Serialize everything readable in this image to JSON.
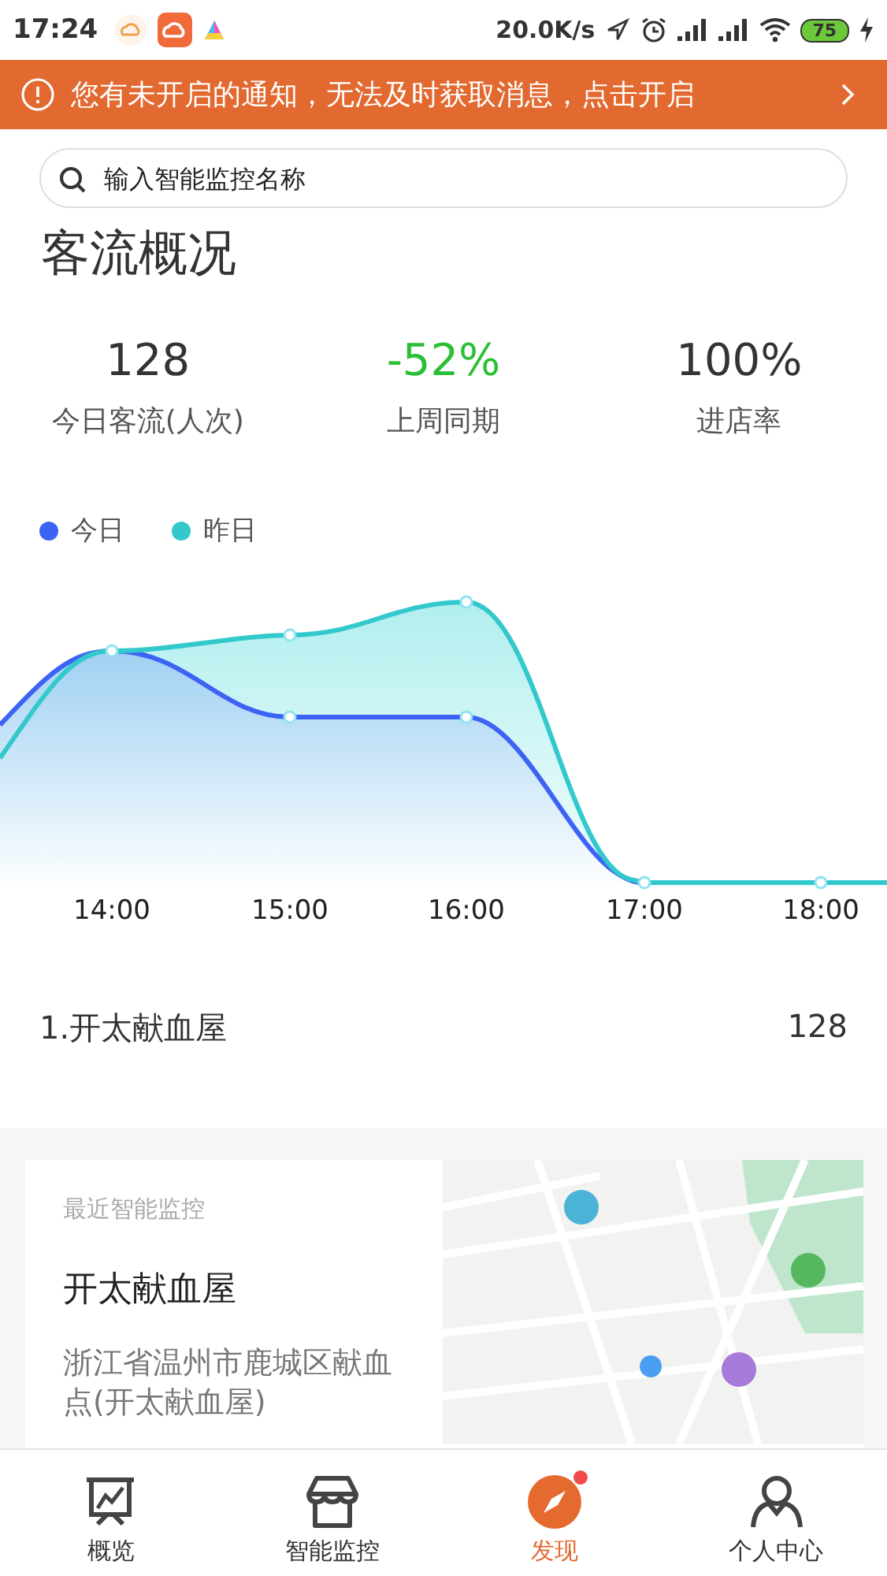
{
  "status_bar": {
    "time": "17:24",
    "speed": "20.0K/s",
    "battery": "75"
  },
  "notice": {
    "text": "您有未开启的通知，无法及时获取消息，点击开启"
  },
  "search": {
    "placeholder": "输入智能监控名称"
  },
  "section_title": "客流概况",
  "stats": [
    {
      "value": "128",
      "label": "今日客流(人次)",
      "kind": "normal"
    },
    {
      "value": "-52%",
      "label": "上周同期",
      "kind": "change"
    },
    {
      "value": "100%",
      "label": "进店率",
      "kind": "normal"
    }
  ],
  "chart": {
    "legend": [
      {
        "label": "今日",
        "color": "#3d63f5"
      },
      {
        "label": "昨日",
        "color": "#33c9cc"
      }
    ],
    "x_labels": [
      "14:00",
      "15:00",
      "16:00",
      "17:00",
      "18:00"
    ]
  },
  "ranking": [
    {
      "name": "1.开太献血屋",
      "count": "128"
    }
  ],
  "recent": {
    "heading": "最近智能监控",
    "name": "开太献血屋",
    "address": "浙江省温州市鹿城区献血点(开太献血屋)"
  },
  "nav": [
    {
      "label": "概览",
      "selected": false,
      "badge": false
    },
    {
      "label": "智能监控",
      "selected": false,
      "badge": false
    },
    {
      "label": "发现",
      "selected": true,
      "badge": true
    },
    {
      "label": "个人中心",
      "selected": false,
      "badge": false
    }
  ]
}
